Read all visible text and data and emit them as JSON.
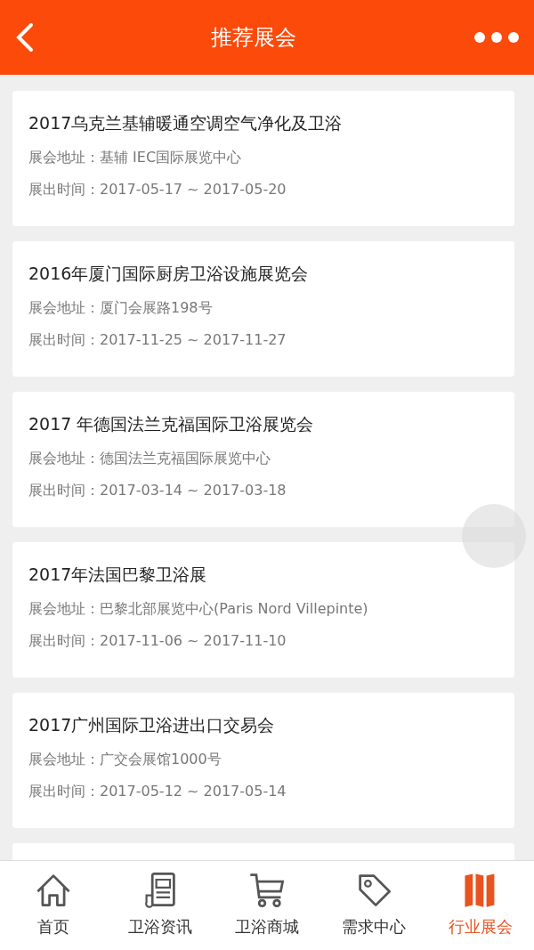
{
  "header": {
    "title": "推荐展会"
  },
  "exhibitions": [
    {
      "title": "2017乌克兰基辅暖通空调空气净化及卫浴",
      "address": "展会地址：基辅 IEC国际展览中心",
      "time": "展出时间：2017-05-17 ~ 2017-05-20"
    },
    {
      "title": "2016年厦门国际厨房卫浴设施展览会",
      "address": "展会地址：厦门会展路198号",
      "time": "展出时间：2017-11-25 ~ 2017-11-27"
    },
    {
      "title": "2017 年德国法兰克福国际卫浴展览会",
      "address": "展会地址：德国法兰克福国际展览中心",
      "time": "展出时间：2017-03-14 ~ 2017-03-18"
    },
    {
      "title": "2017年法国巴黎卫浴展",
      "address": "展会地址：巴黎北部展览中心(Paris Nord Villepinte)",
      "time": "展出时间：2017-11-06 ~ 2017-11-10"
    },
    {
      "title": "2017广州国际卫浴进出口交易会",
      "address": "展会地址：广交会展馆1000号",
      "time": "展出时间：2017-05-12 ~ 2017-05-14"
    }
  ],
  "tabs": [
    {
      "label": "首页",
      "kind": "home",
      "selected": false
    },
    {
      "label": "卫浴资讯",
      "kind": "news",
      "selected": false
    },
    {
      "label": "卫浴商城",
      "kind": "cart",
      "selected": false
    },
    {
      "label": "需求中心",
      "kind": "tag",
      "selected": false
    },
    {
      "label": "行业展会",
      "kind": "map",
      "selected": true
    }
  ]
}
